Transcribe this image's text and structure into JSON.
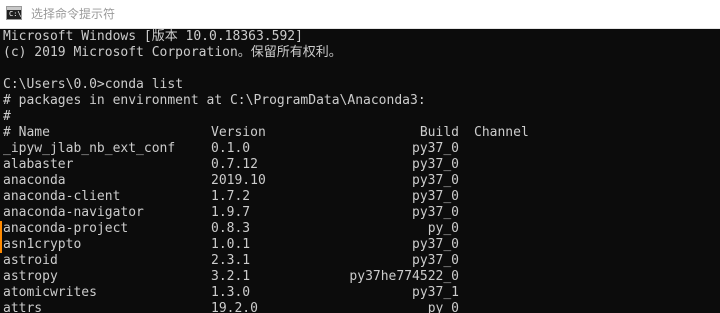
{
  "window": {
    "title": "选择命令提示符",
    "icon": "command-prompt-icon",
    "icon_glyph": "C:\\_"
  },
  "console": {
    "banner": [
      "Microsoft Windows [版本 10.0.18363.592]",
      "(c) 2019 Microsoft Corporation。保留所有权利。"
    ],
    "prompt": "C:\\Users\\0.0>",
    "command": "conda list",
    "comment_env": "# packages in environment at C:\\ProgramData\\Anaconda3:",
    "comment_blank": "#",
    "header": {
      "name": "# Name",
      "version": "Version",
      "build": "Build",
      "channel": "Channel"
    },
    "packages": [
      {
        "name": "_ipyw_jlab_nb_ext_conf",
        "version": "0.1.0",
        "build": "py37_0"
      },
      {
        "name": "alabaster",
        "version": "0.7.12",
        "build": "py37_0"
      },
      {
        "name": "anaconda",
        "version": "2019.10",
        "build": "py37_0"
      },
      {
        "name": "anaconda-client",
        "version": "1.7.2",
        "build": "py37_0"
      },
      {
        "name": "anaconda-navigator",
        "version": "1.9.7",
        "build": "py37_0"
      },
      {
        "name": "anaconda-project",
        "version": "0.8.3",
        "build": "py_0"
      },
      {
        "name": "asn1crypto",
        "version": "1.0.1",
        "build": "py37_0"
      },
      {
        "name": "astroid",
        "version": "2.3.1",
        "build": "py37_0"
      },
      {
        "name": "astropy",
        "version": "3.2.1",
        "build": "py37he774522_0"
      },
      {
        "name": "atomicwrites",
        "version": "1.3.0",
        "build": "py37_1"
      },
      {
        "name": "attrs",
        "version": "19.2.0",
        "build": "py_0"
      }
    ]
  },
  "colors": {
    "console_bg": "#0c0c0c",
    "console_fg": "#cccccc",
    "titlebar_bg": "#ffffff",
    "title_fg": "#9a9a9a",
    "edge_mark": "#ff8a00"
  }
}
